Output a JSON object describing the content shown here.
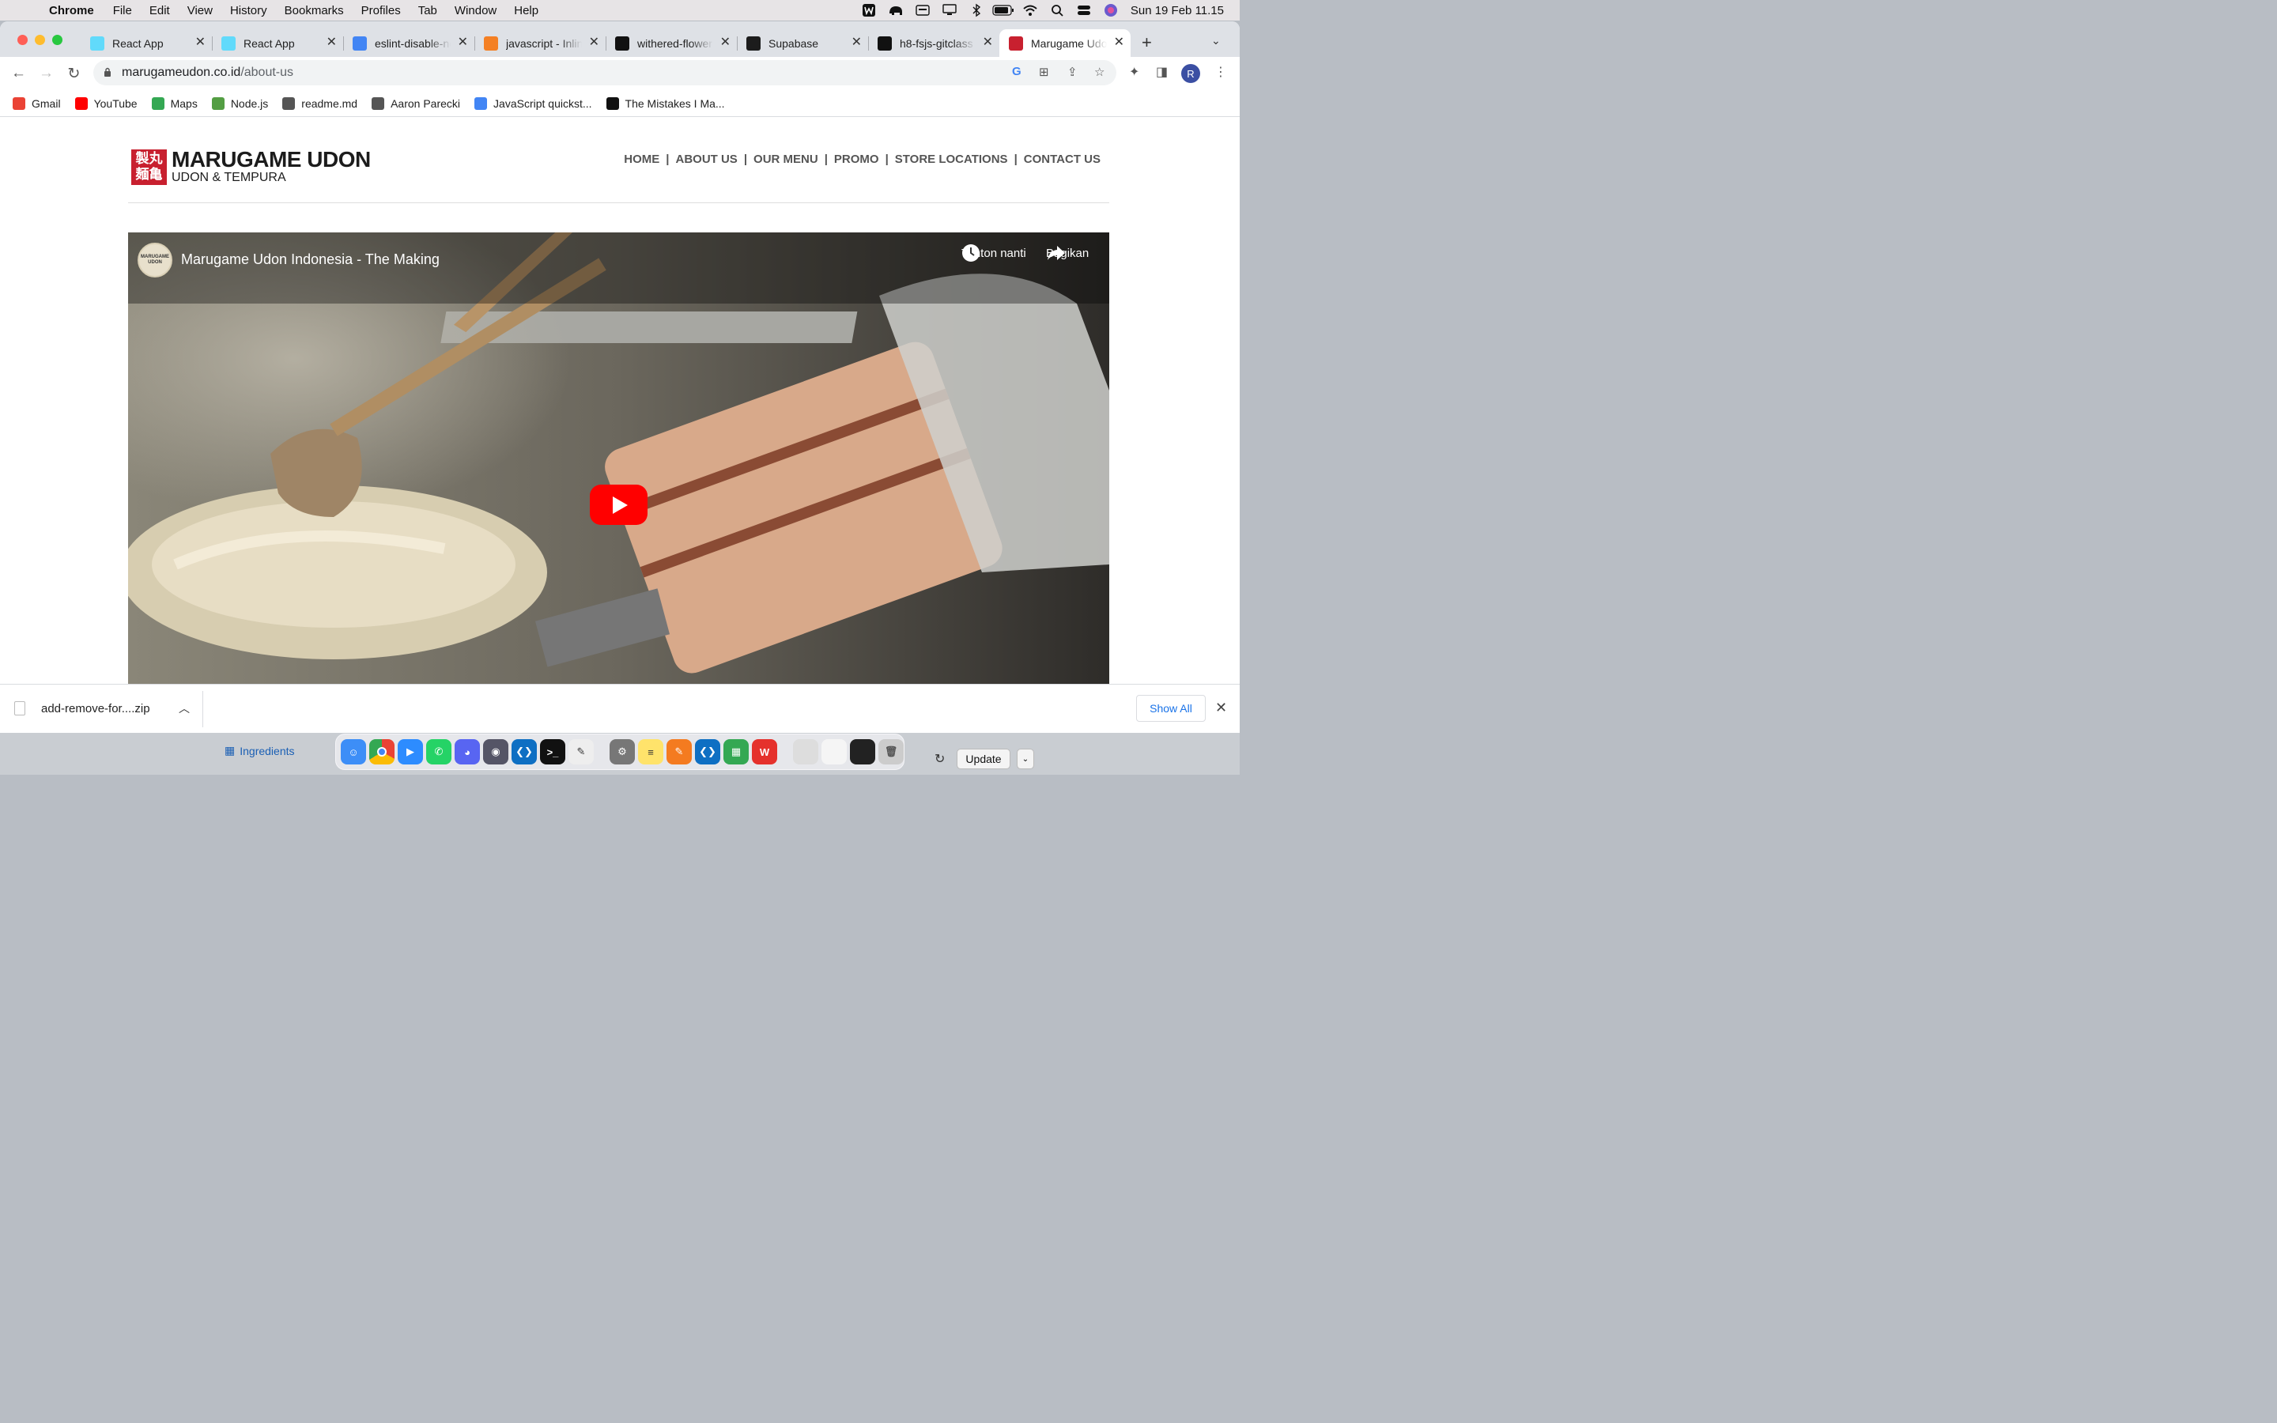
{
  "menubar": {
    "app": "Chrome",
    "items": [
      "File",
      "Edit",
      "View",
      "History",
      "Bookmarks",
      "Profiles",
      "Tab",
      "Window",
      "Help"
    ],
    "datetime": "Sun 19 Feb  11.15"
  },
  "tabs": [
    {
      "title": "React App",
      "icon": "react-icon",
      "color": "#61dafb"
    },
    {
      "title": "React App",
      "icon": "react-icon",
      "color": "#61dafb"
    },
    {
      "title": "eslint-disable-next-line",
      "icon": "google-icon",
      "color": "#4285f4"
    },
    {
      "title": "javascript - Inline",
      "icon": "stackoverflow-icon",
      "color": "#f48024"
    },
    {
      "title": "withered-flower",
      "icon": "github-icon",
      "color": "#111111"
    },
    {
      "title": "Supabase",
      "icon": "supabase-icon",
      "color": "#1c1c1c"
    },
    {
      "title": "h8-fsjs-gitclass",
      "icon": "github-icon",
      "color": "#111111"
    },
    {
      "title": "Marugame Udon",
      "icon": "marugame-icon",
      "color": "#c8202f",
      "active": true
    }
  ],
  "address": {
    "domain": "marugameudon.co.id",
    "path": "/about-us"
  },
  "bookmarks": [
    {
      "label": "Gmail",
      "icon": "gmail-icon",
      "color": "#ea4335"
    },
    {
      "label": "YouTube",
      "icon": "youtube-icon",
      "color": "#ff0000"
    },
    {
      "label": "Maps",
      "icon": "maps-icon",
      "color": "#34a853"
    },
    {
      "label": "Node.js",
      "icon": "nodejs-icon",
      "color": "#539e43"
    },
    {
      "label": "readme.md",
      "icon": "globe-icon",
      "color": "#555555"
    },
    {
      "label": "Aaron Parecki",
      "icon": "globe-icon",
      "color": "#555555"
    },
    {
      "label": "JavaScript quickst...",
      "icon": "code-icon",
      "color": "#4285f4"
    },
    {
      "label": "The Mistakes I Ma...",
      "icon": "medium-icon",
      "color": "#111111"
    }
  ],
  "site": {
    "logo_line1": "MARUGAME UDON",
    "logo_line2": "UDON & TEMPURA",
    "logo_mark": "製丸\n麺亀",
    "nav": [
      "HOME",
      "ABOUT US",
      "OUR MENU",
      "PROMO",
      "STORE LOCATIONS",
      "CONTACT US"
    ]
  },
  "video": {
    "title": "Marugame Udon Indonesia - The Making",
    "channel": "MARUGAME UDON",
    "watch_later": "Tonton nanti",
    "share": "Bagikan"
  },
  "download": {
    "file": "add-remove-for....zip",
    "show_all": "Show All"
  },
  "background": {
    "ingredients": "Ingredients",
    "update": "Update"
  },
  "colors": {
    "brand": "#c8202f",
    "link": "#1a73e8",
    "youtube": "#ff0000"
  }
}
